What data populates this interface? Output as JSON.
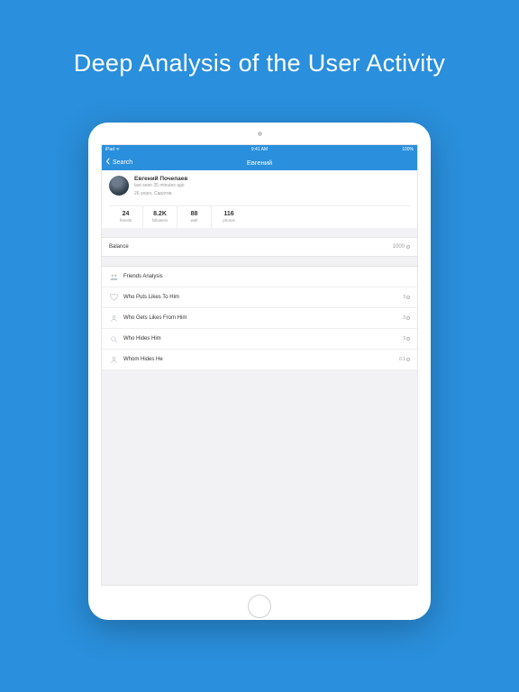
{
  "headline": "Deep Analysis of the User Activity",
  "statusbar": {
    "carrier": "iPad ᯤ",
    "time": "9:41 AM",
    "battery": "100%"
  },
  "navbar": {
    "back_label": "Search",
    "title": "Евгений"
  },
  "profile": {
    "name": "Евгений Почепаев",
    "last_seen": "last seen 35 minutes ago",
    "age_location": "26 years, Саратов"
  },
  "stats": [
    {
      "value": "24",
      "label": "friends"
    },
    {
      "value": "8.2K",
      "label": "followers"
    },
    {
      "value": "88",
      "label": "wall"
    },
    {
      "value": "116",
      "label": "photos"
    }
  ],
  "balance": {
    "label": "Balance",
    "credits": "1000"
  },
  "menu": [
    {
      "icon": "people",
      "label": "Friends Analysis",
      "price": ""
    },
    {
      "icon": "heart",
      "label": "Who Puts Likes To Him",
      "price": "3"
    },
    {
      "icon": "person",
      "label": "Who Gets Likes From Him",
      "price": "3"
    },
    {
      "icon": "search",
      "label": "Who Hides Him",
      "price": "3"
    },
    {
      "icon": "person",
      "label": "Whom Hides He",
      "price": "0.1"
    }
  ]
}
